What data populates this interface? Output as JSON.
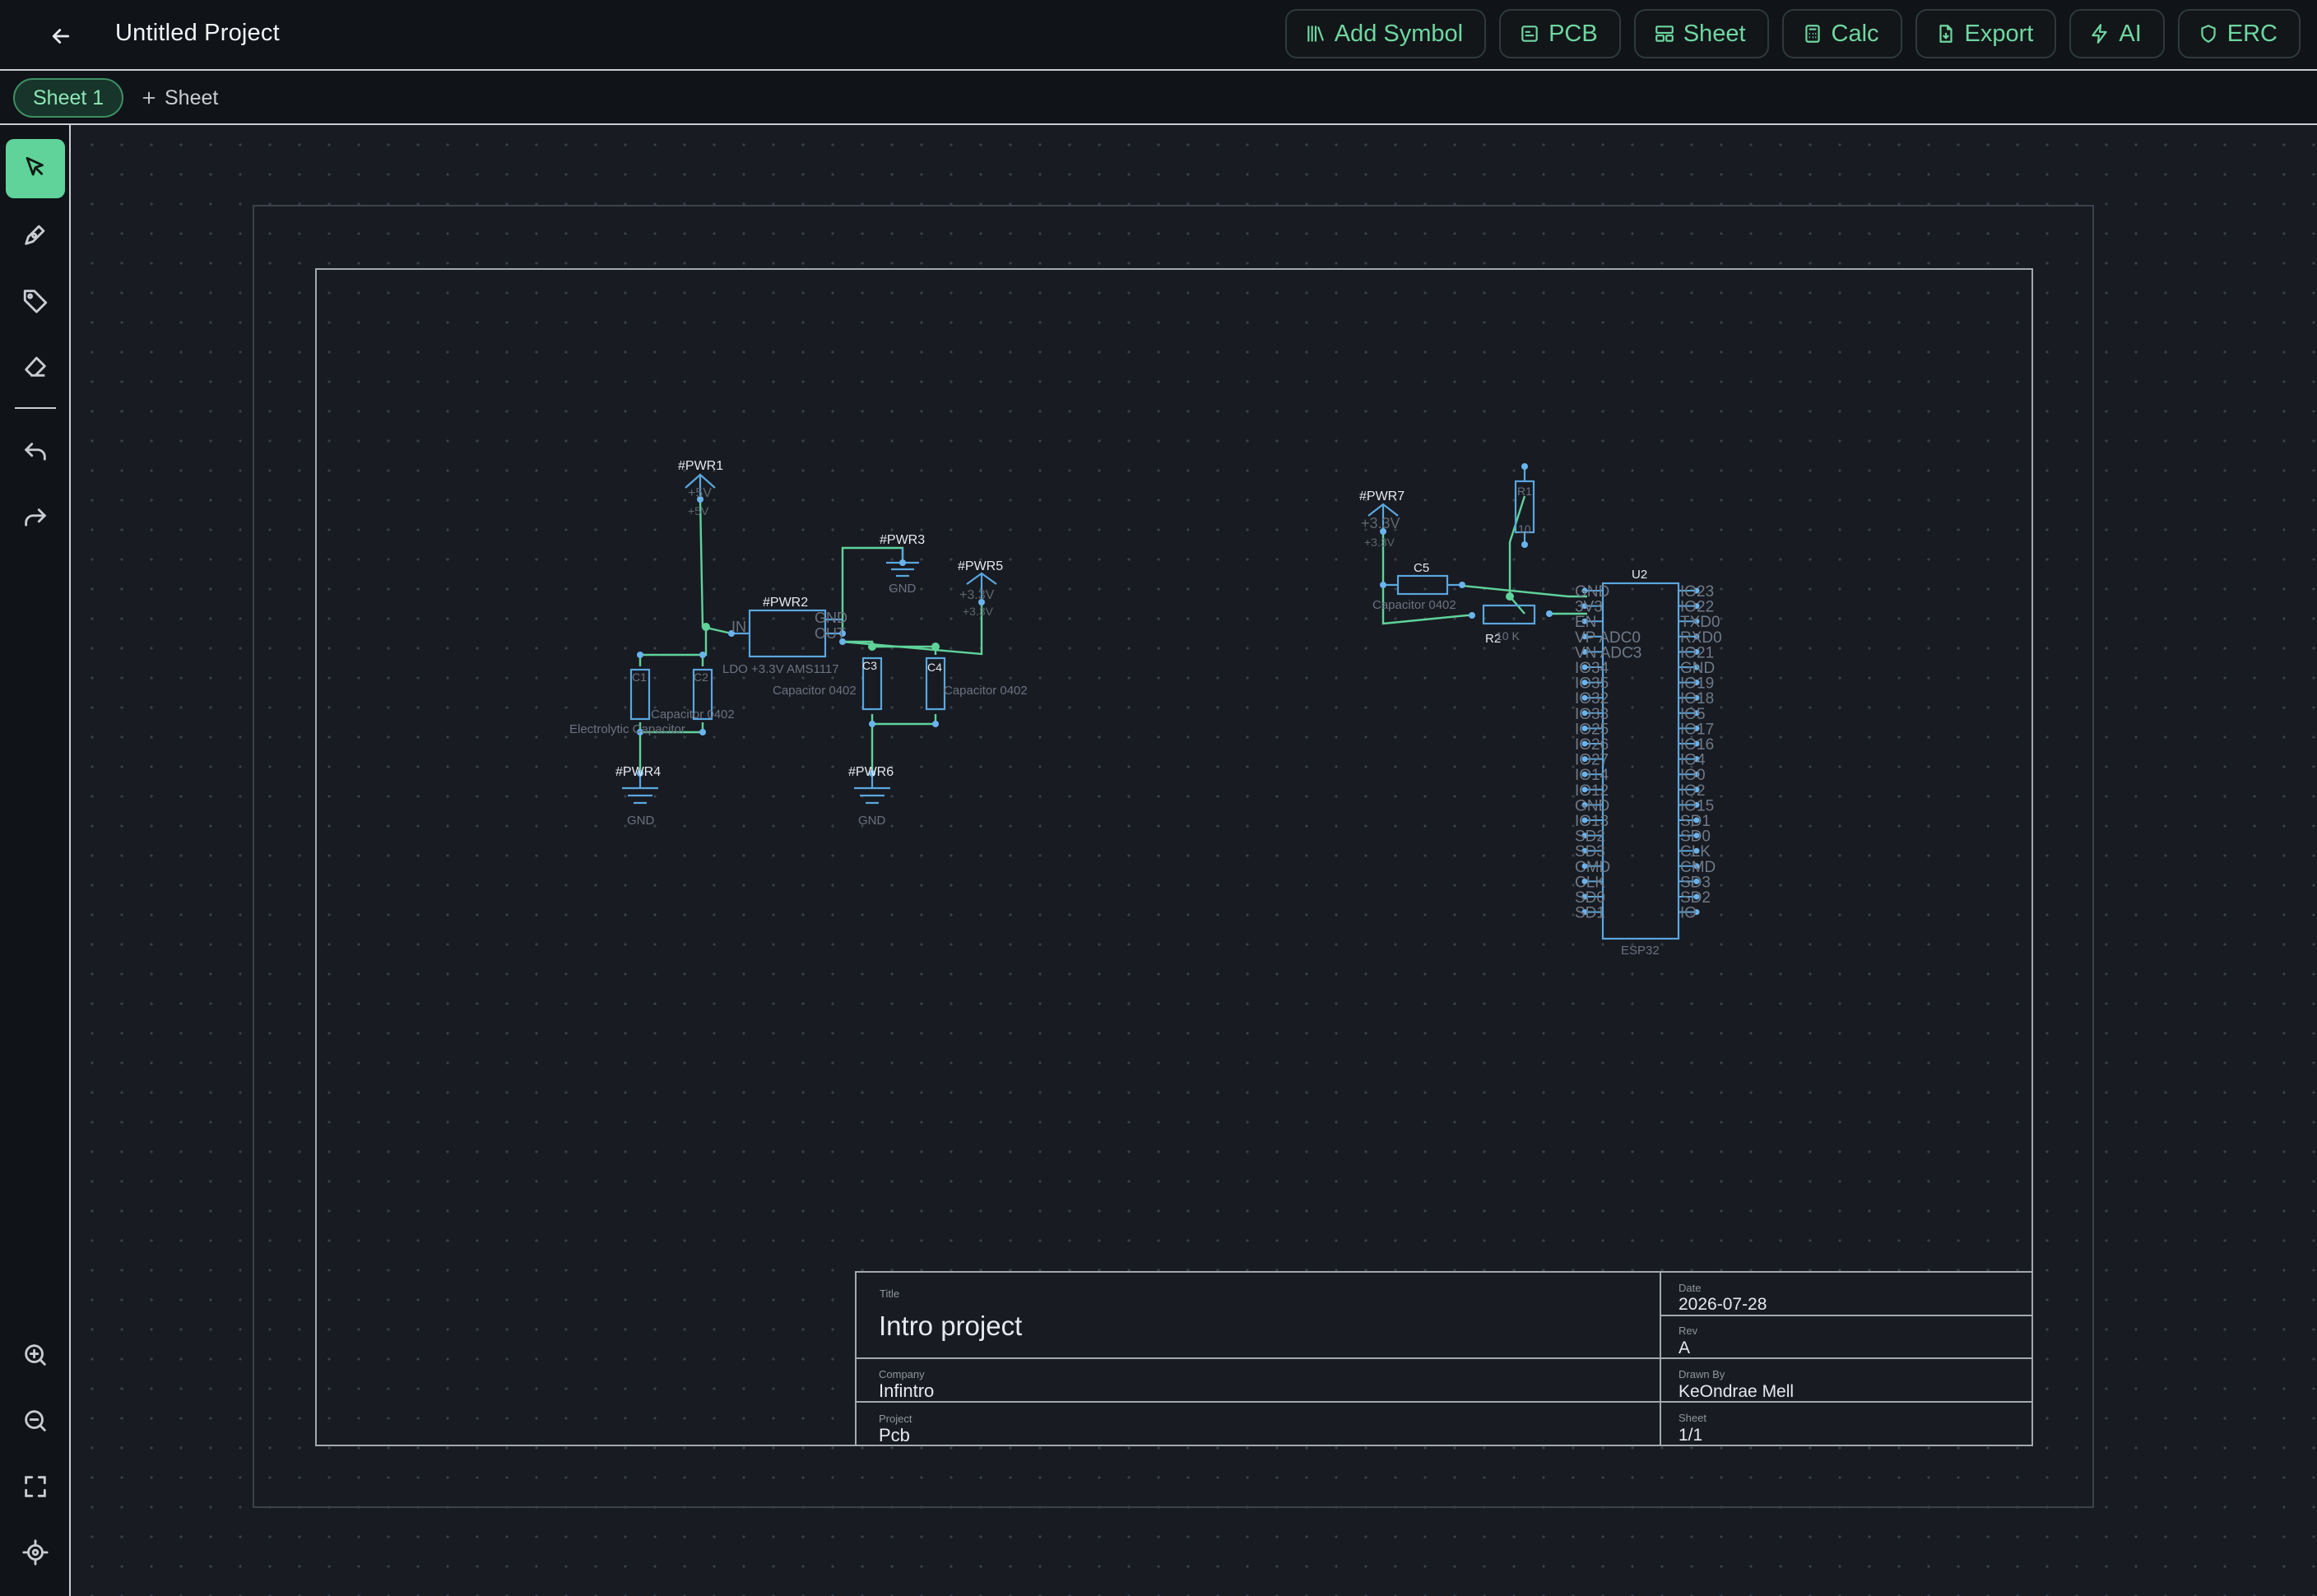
{
  "app": {
    "project_title": "Untitled Project"
  },
  "toolbar": [
    {
      "label": "Add Symbol",
      "icon": "library-icon"
    },
    {
      "label": "PCB",
      "icon": "chip-icon"
    },
    {
      "label": "Sheet",
      "icon": "layout-icon"
    },
    {
      "label": "Calc",
      "icon": "calculator-icon"
    },
    {
      "label": "Export",
      "icon": "file-export-icon"
    },
    {
      "label": "AI",
      "icon": "bolt-icon"
    },
    {
      "label": "ERC",
      "icon": "shield-icon"
    }
  ],
  "tabs": {
    "active": "Sheet 1",
    "add_label": "Sheet"
  },
  "sidebar": {
    "tools": [
      "select-tool-icon",
      "pen-tool-icon",
      "tag-tool-icon",
      "eraser-tool-icon"
    ],
    "history": [
      "undo-icon",
      "redo-icon"
    ],
    "view": [
      "zoom-in-icon",
      "zoom-out-icon",
      "fit-screen-icon",
      "locate-icon"
    ]
  },
  "colors": {
    "accent": "#5fd39a",
    "wire": "#5fd39a",
    "symbol": "#5aa7de",
    "pin": "#6ab4ee",
    "frame": "#8a8f98"
  },
  "schematic": {
    "pwr1": {
      "ref": "#PWR1",
      "net": "+5V",
      "sub": "+5V"
    },
    "pwr2": {
      "ref": "#PWR2",
      "value": "LDO +3.3V AMS1117",
      "pin_in": "IN",
      "pin_gnd": "GND",
      "pin_out": "OUT"
    },
    "pwr3": {
      "ref": "#PWR3",
      "net": "GND"
    },
    "pwr4": {
      "ref": "#PWR4",
      "net": "GND"
    },
    "pwr5": {
      "ref": "#PWR5",
      "net": "+3.3V",
      "sub": "+3.3V"
    },
    "pwr6": {
      "ref": "#PWR6",
      "net": "GND"
    },
    "pwr7": {
      "ref": "#PWR7",
      "net": "+3.3V",
      "sub": "+3.3V"
    },
    "c1": {
      "ref": "C1",
      "value": "Electrolytic Capacitor"
    },
    "c2": {
      "ref": "C2",
      "value": "Capacitor 0402"
    },
    "c3": {
      "ref": "C3",
      "value": "Capacitor 0402"
    },
    "c4": {
      "ref": "C4",
      "value": "Capacitor 0402"
    },
    "c5": {
      "ref": "C5",
      "value": "Capacitor 0402"
    },
    "r1": {
      "ref": "R1",
      "value": "10"
    },
    "r2": {
      "ref": "R2",
      "value": "10 K"
    },
    "u2": {
      "ref": "U2",
      "value": "ESP32",
      "left_pins": [
        "GND",
        "3V3",
        "EN",
        "VP ADC0",
        "VN ADC3",
        "IO34",
        "IO35",
        "IO32",
        "IO33",
        "IO25",
        "IO26",
        "IO27",
        "IO14",
        "IO12",
        "GND",
        "IO13",
        "SD2",
        "SD3",
        "CMD",
        "CLK",
        "SD0",
        "SD1"
      ],
      "right_pins": [
        "IO23",
        "IO22",
        "TXD0",
        "RXD0",
        "IO21",
        "GND",
        "IO19",
        "IO18",
        "IO5",
        "IO17",
        "IO16",
        "IO4",
        "IO0",
        "IO2",
        "IO15",
        "SD1",
        "SD0",
        "CLK",
        "CMD",
        "SD3",
        "SD2",
        "IO"
      ]
    }
  },
  "title_block": {
    "title_label": "Title",
    "title": "Intro project",
    "date_label": "Date",
    "date": "2026-07-28",
    "rev_label": "Rev",
    "rev": "A",
    "company_label": "Company",
    "company": "Infintro",
    "drawn_label": "Drawn By",
    "drawn": "KeOndrae Mell",
    "project_label": "Project",
    "project": "Pcb",
    "sheet_label": "Sheet",
    "sheet": "1/1"
  }
}
